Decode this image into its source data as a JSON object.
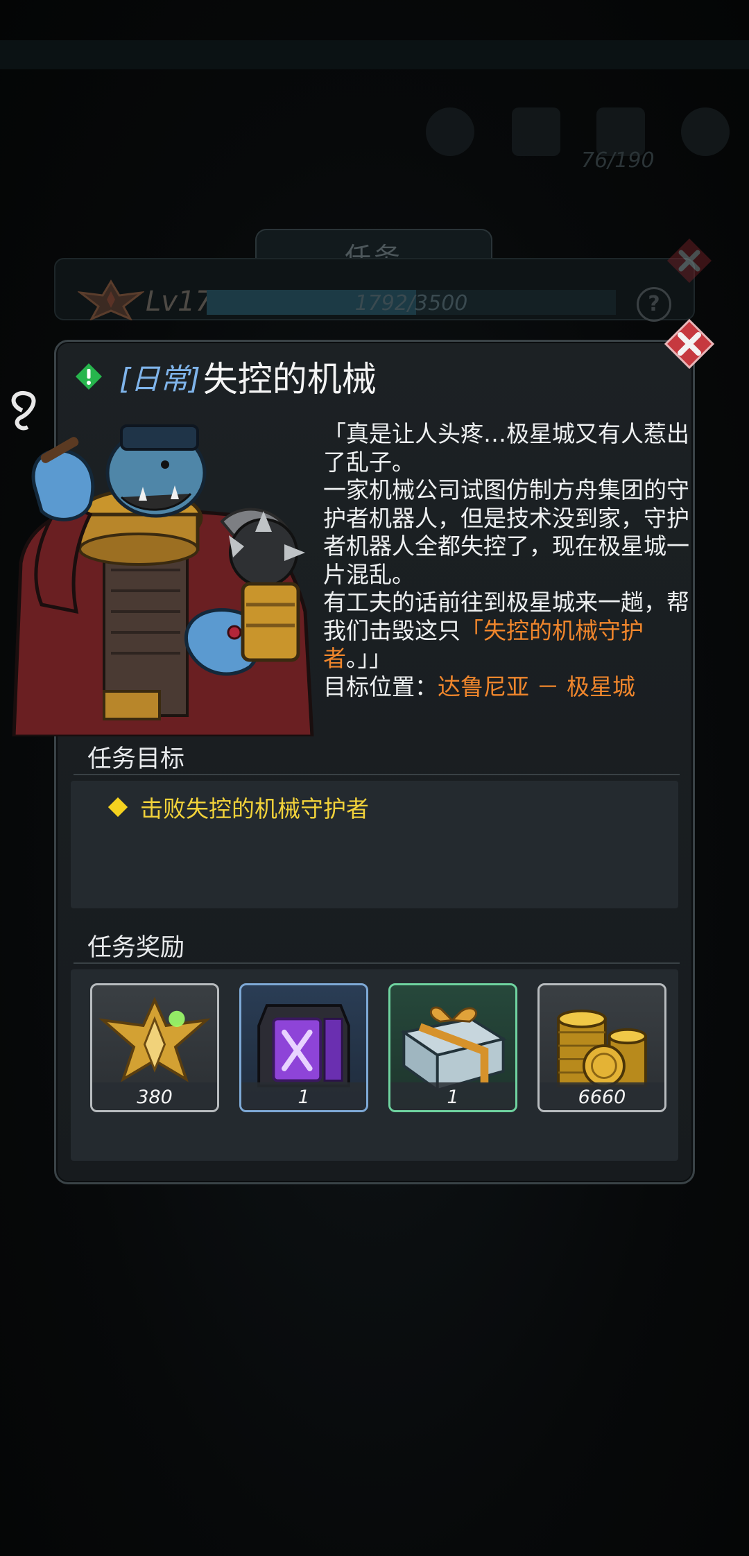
{
  "background": {
    "resource_counter": "76/190",
    "panel_title": "任务",
    "level": "Lv17",
    "xp": {
      "current": 1792,
      "max": 3500,
      "text": "1792/3500"
    },
    "help_label": "?"
  },
  "quest": {
    "tag": "[日常]",
    "title": "失控的机械",
    "description": {
      "line1": "「真是让人头疼…极星城又有人惹出了乱子。",
      "line2": "一家机械公司试图仿制方舟集团的守护者机器人，但是技术没到家，守护者机器人全都失控了，现在极星城一片混乱。",
      "line3_prefix": "有工夫的话前往到极星城来一趟，帮我们击毁这只",
      "line3_highlight": "「失控的机械守护者",
      "line3_suffix": "。」」"
    },
    "target_label": "目标位置：",
    "target_value": "达鲁尼亚 － 极星城"
  },
  "objectives": {
    "title": "任务目标",
    "items": [
      "击败失控的机械守护者"
    ]
  },
  "rewards": {
    "title": "任务奖励",
    "items": [
      {
        "name": "rank-emblem",
        "count": "380",
        "rarity": "gray"
      },
      {
        "name": "purple-crate",
        "count": "1",
        "rarity": "blue"
      },
      {
        "name": "gift-box",
        "count": "1",
        "rarity": "green"
      },
      {
        "name": "gold-coins",
        "count": "6660",
        "rarity": "gray"
      }
    ]
  },
  "colors": {
    "highlight": "#f0862c",
    "objective": "#f2d23a",
    "tag": "#7fb4ea",
    "close": "#c6393f"
  }
}
